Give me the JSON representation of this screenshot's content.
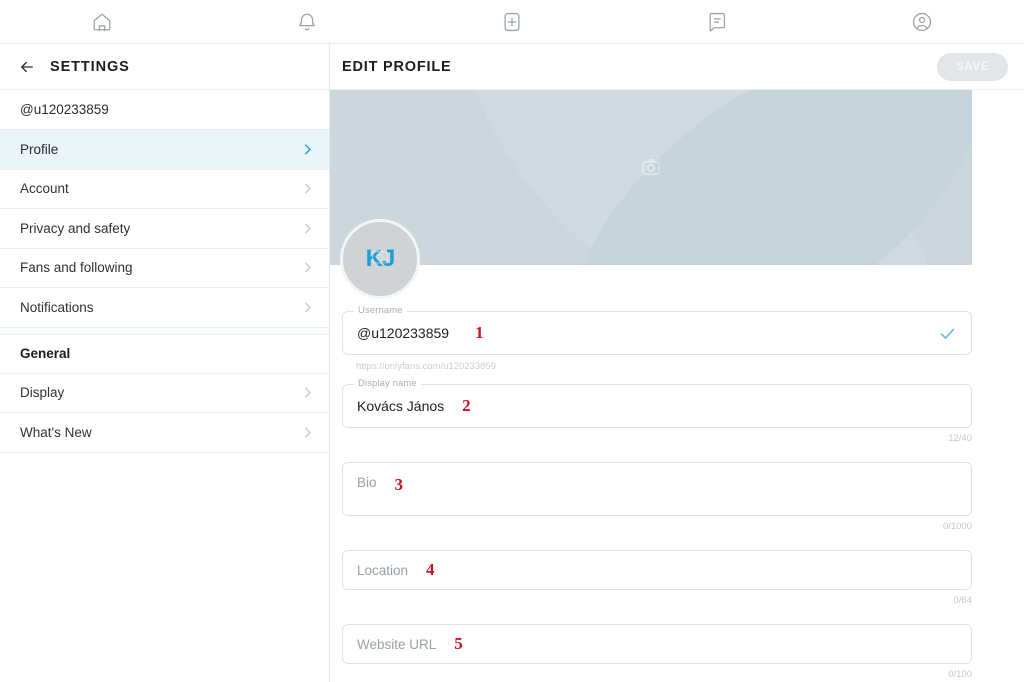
{
  "topnav": {
    "items": [
      {
        "name": "home-icon",
        "label": "Home"
      },
      {
        "name": "bell-icon",
        "label": "Notifications"
      },
      {
        "name": "add-post-icon",
        "label": "New post"
      },
      {
        "name": "messages-icon",
        "label": "Messages"
      },
      {
        "name": "profile-icon",
        "label": "Profile"
      }
    ]
  },
  "sidebar": {
    "title": "SETTINGS",
    "back_icon": "back-arrow-icon",
    "account": "@u120233859",
    "items": [
      {
        "label": "Profile",
        "active": true
      },
      {
        "label": "Account",
        "active": false
      },
      {
        "label": "Privacy and safety",
        "active": false
      },
      {
        "label": "Fans and following",
        "active": false
      },
      {
        "label": "Notifications",
        "active": false
      }
    ],
    "section_general": "General",
    "general_items": [
      {
        "label": "Display"
      },
      {
        "label": "What's New"
      }
    ]
  },
  "content": {
    "title": "EDIT PROFILE",
    "save_label": "SAVE",
    "banner": {
      "camera_icon": "camera-icon"
    },
    "avatar": {
      "initials": "KJ",
      "camera_icon": "camera-icon"
    },
    "fields": {
      "username": {
        "legend": "Username",
        "value": "@u120233859",
        "hint": "https://onlyfans.com/u120233859",
        "valid_icon": "check-icon",
        "annotation": "1"
      },
      "display_name": {
        "legend": "Display name",
        "value": "Kovács János",
        "counter": "12/40",
        "annotation": "2"
      },
      "bio": {
        "placeholder": "Bio",
        "counter": "0/1000",
        "annotation": "3"
      },
      "location": {
        "placeholder": "Location",
        "counter": "0/64",
        "annotation": "4"
      },
      "website": {
        "placeholder": "Website URL",
        "counter": "0/100",
        "annotation": "5"
      }
    }
  },
  "colors": {
    "accent": "#1e9ed9",
    "active_row": "#eaf4f9",
    "annotation_red": "#cc1122",
    "banner": "#ccd7dd"
  }
}
